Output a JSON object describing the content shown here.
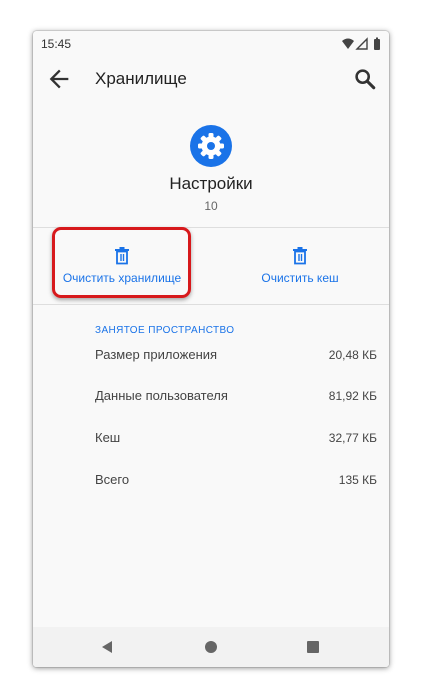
{
  "status_bar": {
    "time": "15:45"
  },
  "app_bar": {
    "title": "Хранилище"
  },
  "app": {
    "name": "Настройки",
    "version": "10"
  },
  "actions": {
    "clear_storage": "Очистить хранилище",
    "clear_cache": "Очистить кеш"
  },
  "storage": {
    "header": "ЗАНЯТОЕ ПРОСТРАНСТВО",
    "rows": [
      {
        "label": "Размер приложения",
        "value": "20,48 КБ"
      },
      {
        "label": "Данные пользователя",
        "value": "81,92 КБ"
      },
      {
        "label": "Кеш",
        "value": "32,77 КБ"
      },
      {
        "label": "Всего",
        "value": "135 КБ"
      }
    ]
  },
  "colors": {
    "accent": "#1a73e8",
    "highlight": "#d7191c"
  },
  "icons": [
    "wifi-icon",
    "signal-icon",
    "battery-icon",
    "back-arrow-icon",
    "search-icon",
    "settings-gear-icon",
    "trash-icon",
    "nav-back-icon",
    "nav-home-icon",
    "nav-recents-icon"
  ]
}
